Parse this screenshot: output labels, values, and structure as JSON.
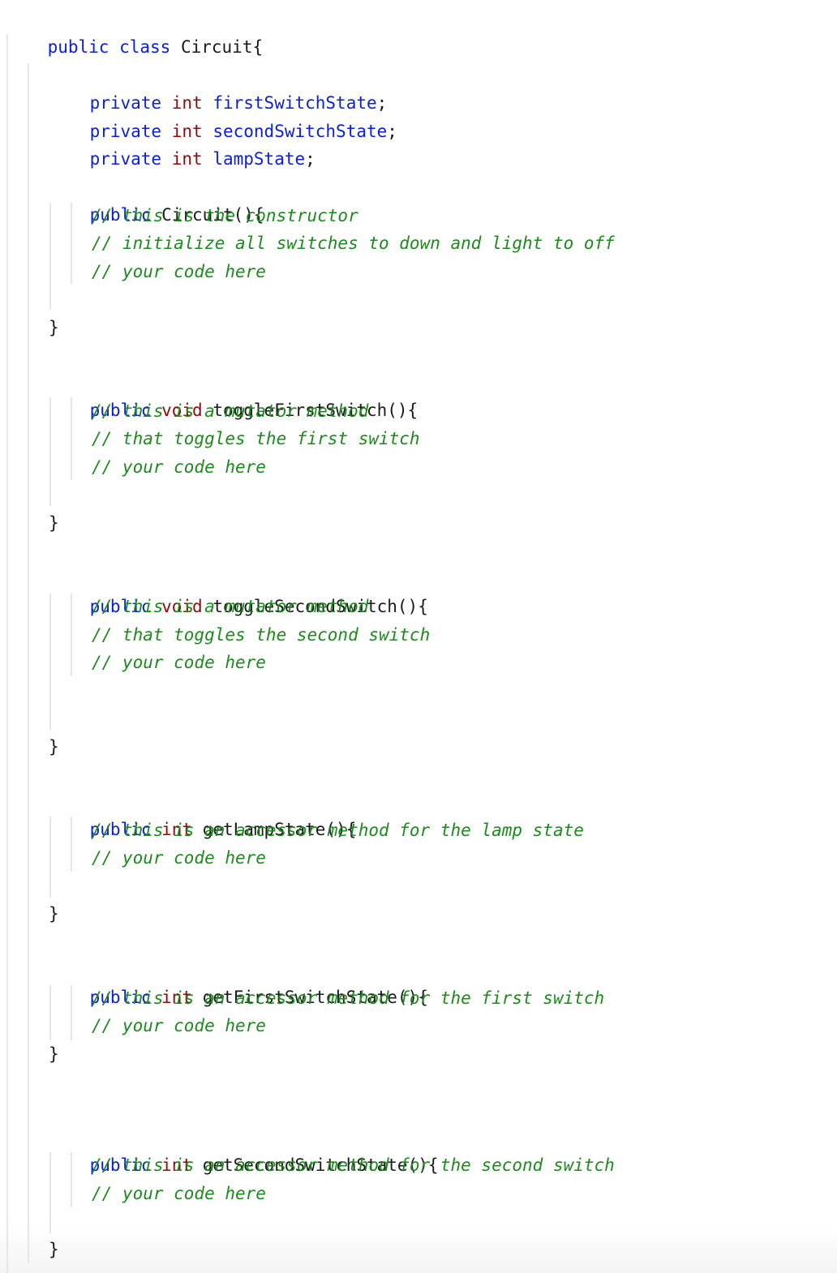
{
  "document": {
    "language": "java",
    "colors": {
      "keyword": "#0b1fd6",
      "type": "#8b0d0d",
      "field": "#0b1fd6",
      "comment": "#1c8a1c",
      "plain": "#1a1a1a"
    },
    "class_header": {
      "modifier": "public",
      "keyword": "class",
      "name_brace": "Circuit{"
    },
    "fields": [
      {
        "modifier": "private",
        "type": "int",
        "name": "firstSwitchState",
        "end": ";"
      },
      {
        "modifier": "private",
        "type": "int",
        "name": "secondSwitchState",
        "end": ";"
      },
      {
        "modifier": "private",
        "type": "int",
        "name": "lampState",
        "end": ";"
      }
    ],
    "constructor": {
      "modifier": "public",
      "signature": "Circuit(){",
      "comments": [
        "// this is the constructor",
        "// initialize all switches to down and light to off",
        "// your code here"
      ],
      "close": "}"
    },
    "methods": [
      {
        "modifier": "public",
        "return_type": "void",
        "signature": "toggleFirstSwitch(){",
        "comments": [
          "// this is a mutator method",
          "// that toggles the first switch",
          "// your code here"
        ],
        "close": "}"
      },
      {
        "modifier": "public",
        "return_type": "void",
        "signature": "toggleSecondSwitch(){",
        "comments": [
          "// this is a mutator method",
          "// that toggles the second switch",
          "// your code here"
        ],
        "close": "}"
      },
      {
        "modifier": "public",
        "return_type": "int",
        "signature": "getLampState(){",
        "comments": [
          "// this is an accessor method for the lamp state",
          "// your code here"
        ],
        "close": "}"
      },
      {
        "modifier": "public",
        "return_type": "int",
        "signature": "getFirstSwitchState(){",
        "comments": [
          "// this is an accessor method for the first switch",
          "// your code here"
        ],
        "close": "}"
      },
      {
        "modifier": "public",
        "return_type": "int",
        "signature": "getSecondSwitchState(){",
        "comments": [
          "// this is an accessor method for the second switch",
          "// your code here"
        ],
        "close": "}"
      }
    ]
  }
}
